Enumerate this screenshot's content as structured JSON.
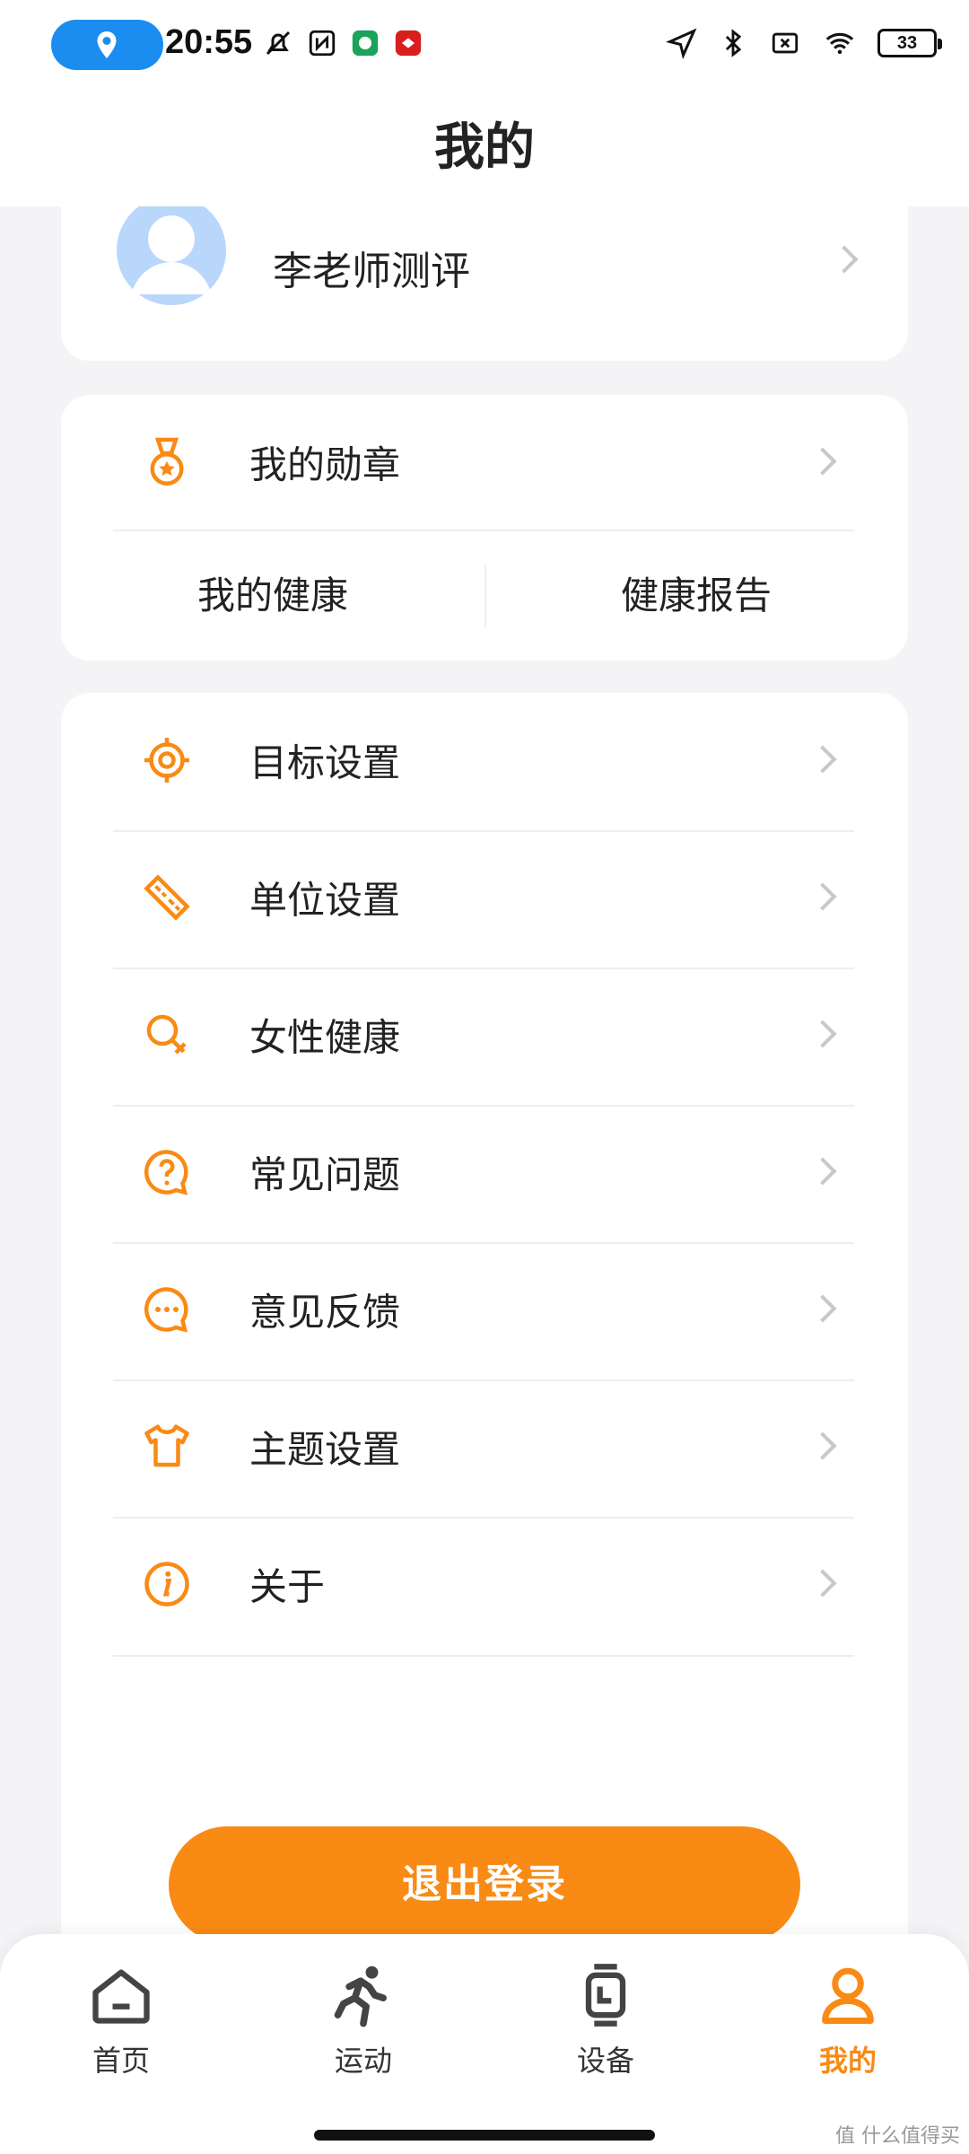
{
  "status_bar": {
    "time": "20:55",
    "battery": "33"
  },
  "header": {
    "title": "我的"
  },
  "profile": {
    "name": "李老师测评"
  },
  "medal_card": {
    "medal_label": "我的勋章",
    "health_left": "我的健康",
    "health_right": "健康报告"
  },
  "menu": {
    "items": [
      {
        "label": "目标设置",
        "icon": "target-icon"
      },
      {
        "label": "单位设置",
        "icon": "ruler-icon"
      },
      {
        "label": "女性健康",
        "icon": "female-icon"
      },
      {
        "label": "常见问题",
        "icon": "question-icon"
      },
      {
        "label": "意见反馈",
        "icon": "chat-icon"
      },
      {
        "label": "主题设置",
        "icon": "tshirt-icon"
      },
      {
        "label": "关于",
        "icon": "info-icon"
      }
    ]
  },
  "logout": {
    "label": "退出登录"
  },
  "bottom_nav": {
    "items": [
      {
        "label": "首页",
        "icon": "home-icon"
      },
      {
        "label": "运动",
        "icon": "running-icon"
      },
      {
        "label": "设备",
        "icon": "watch-icon"
      },
      {
        "label": "我的",
        "icon": "person-icon"
      }
    ]
  },
  "watermark": "值 什么值得买",
  "colors": {
    "accent": "#f98a14",
    "status_pill": "#1b8cf0",
    "background": "#f4f4f6"
  }
}
